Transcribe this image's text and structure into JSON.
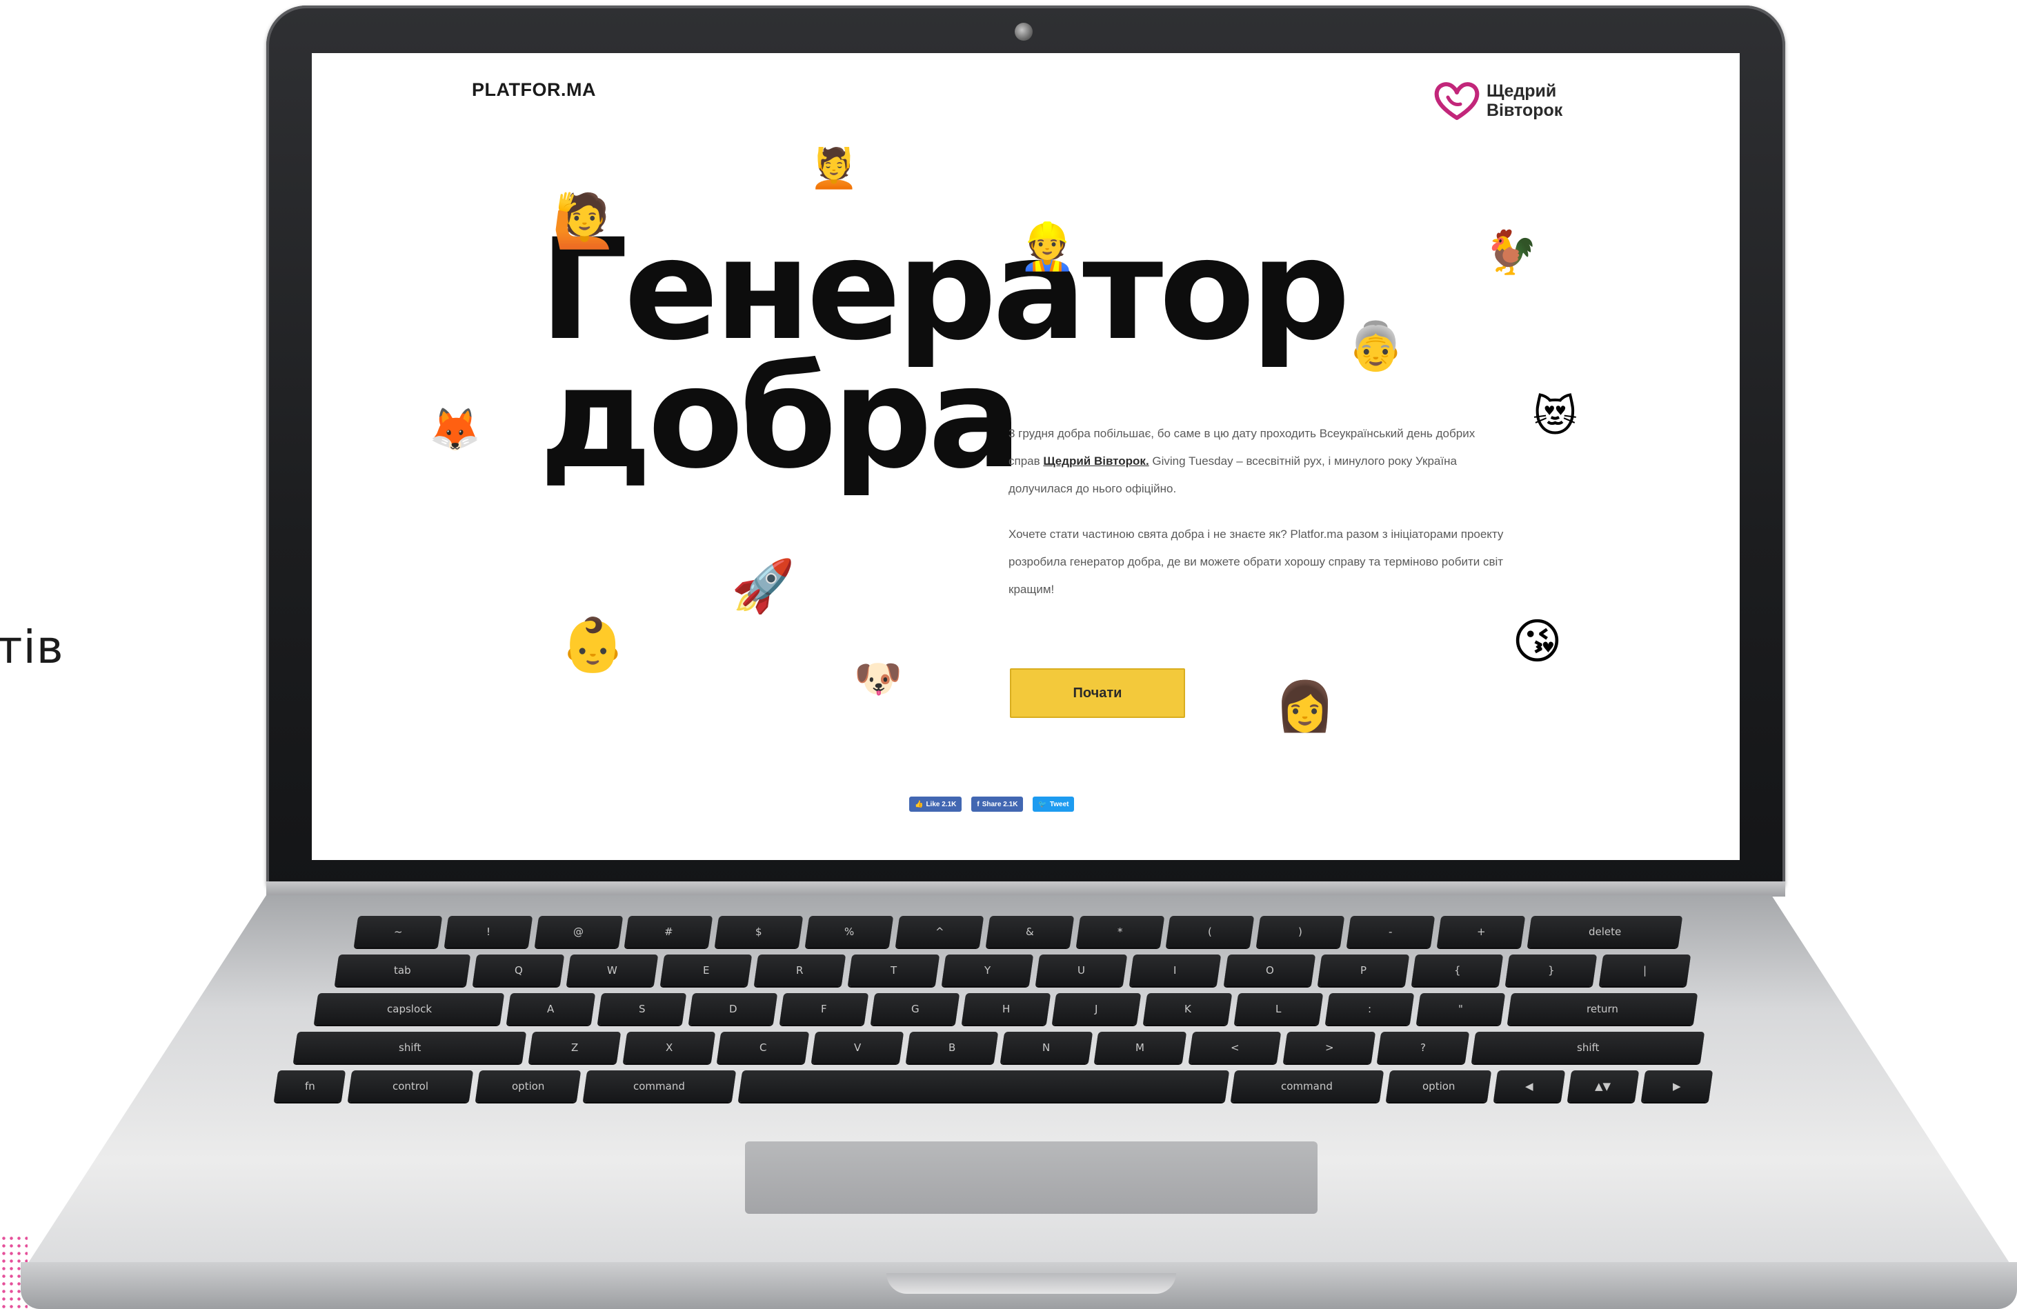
{
  "side": {
    "text": "тів"
  },
  "site": {
    "logo": "PLATFOR.MA",
    "partner_line1": "Щедрий",
    "partner_line2": "Вівторок",
    "title_line1": "Генератор",
    "title_line2": "добра",
    "paragraph1_before": "3 грудня добра побільшає, бо саме в цю дату проходить Всеукраїнський день добрих справ ",
    "paragraph1_link": "Щедрий Вівторок.",
    "paragraph1_after": " Giving Tuesday – всесвітній рух, і минулого року Україна долучилася до нього офіційно.",
    "paragraph2": "Хочете стати частиною свята добра і не знаєте як? Platfor.ma разом з ініціаторами проекту розробила генератор добра, де ви можете обрати хорошу справу та терміново робити світ кращим!",
    "start_label": "Почати",
    "share": {
      "like_label": "Like 2.1K",
      "share_label": "Share 2.1K",
      "tweet_label": "Tweet"
    }
  },
  "emojis": {
    "e1": "💆",
    "e2": "🙋",
    "e3": "👷",
    "e4": "🐓",
    "e5": "👵",
    "e6": "🦊",
    "e7": "😻",
    "e8": "🚀",
    "e9": "👶",
    "e10": "🐶",
    "e11": "😘",
    "e12": "👩"
  },
  "keyboard": {
    "row1": [
      "~",
      "!",
      "@",
      "#",
      "$",
      "%",
      "^",
      "&",
      "*",
      "(",
      ")",
      "-",
      "+",
      "delete"
    ],
    "row2": [
      "tab",
      "Q",
      "W",
      "E",
      "R",
      "T",
      "Y",
      "U",
      "I",
      "O",
      "P",
      "{",
      "}",
      "|"
    ],
    "row3": [
      "capslock",
      "A",
      "S",
      "D",
      "F",
      "G",
      "H",
      "J",
      "K",
      "L",
      ":",
      "\"",
      "return"
    ],
    "row4": [
      "shift",
      "Z",
      "X",
      "C",
      "V",
      "B",
      "N",
      "M",
      "<",
      ">",
      "?",
      "shift"
    ],
    "row5": [
      "fn",
      "control",
      "option",
      "command",
      "",
      "command",
      "option",
      "◀",
      "▲▼",
      "▶"
    ]
  },
  "colors": {
    "button_yellow": "#f3c93b",
    "facebook_blue": "#4267b2",
    "twitter_blue": "#1d9bf0",
    "partner_pink": "#c2267a"
  }
}
